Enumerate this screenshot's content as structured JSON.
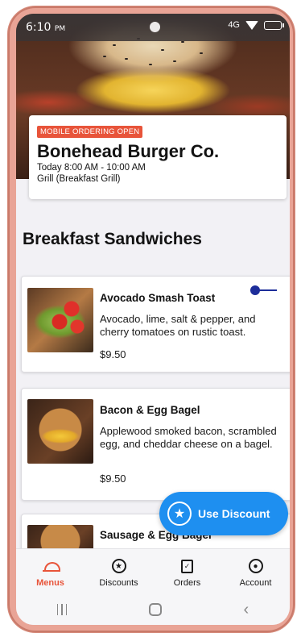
{
  "status_bar": {
    "time": "6:10",
    "ampm": "PM",
    "network": "4G"
  },
  "restaurant": {
    "badge": "MOBILE ORDERING OPEN",
    "name": "Bonehead Burger Co.",
    "hours": "Today 8:00 AM - 10:00 AM",
    "location": "Grill (Breakfast Grill)"
  },
  "section_title": "Breakfast Sandwiches",
  "menu_items": [
    {
      "name": "Avocado Smash Toast",
      "description": "Avocado, lime, salt & pepper, and cherry tomatoes on rustic toast.",
      "price": "$9.50",
      "image_icon": "avocado-toast-photo"
    },
    {
      "name": "Bacon & Egg Bagel",
      "description": "Applewood smoked bacon, scrambled egg, and cheddar cheese on a bagel.",
      "price": "$9.50",
      "image_icon": "bacon-egg-bagel-photo"
    },
    {
      "name": "Sausage & Egg Bagel",
      "description": "",
      "price": "",
      "image_icon": "sausage-egg-bagel-photo"
    }
  ],
  "discount_button": {
    "label": "Use Discount",
    "icon": "star-icon"
  },
  "tabs": [
    {
      "label": "Menus",
      "icon": "cloche-icon",
      "active": true
    },
    {
      "label": "Discounts",
      "icon": "star-icon",
      "active": false
    },
    {
      "label": "Orders",
      "icon": "bag-icon",
      "active": false
    },
    {
      "label": "Account",
      "icon": "account-icon",
      "active": false
    }
  ],
  "colors": {
    "accent": "#e8543a",
    "primary_button": "#1e8ff0",
    "phone_frame": "#e9a496"
  }
}
